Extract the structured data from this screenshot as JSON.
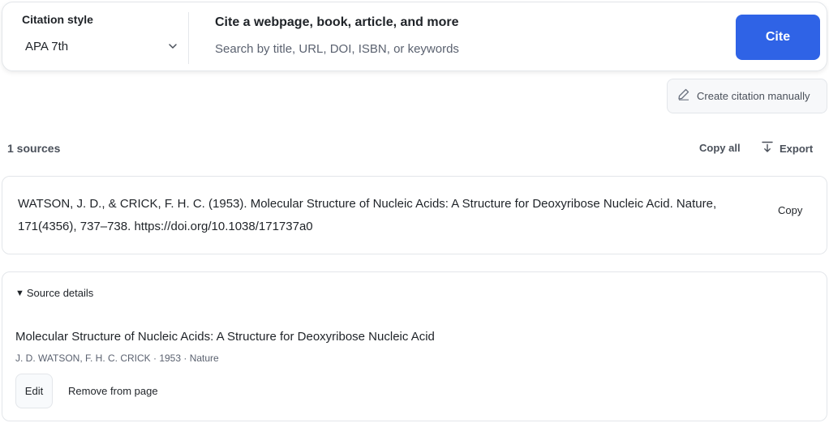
{
  "search": {
    "style_label": "Citation style",
    "style_value": "APA 7th",
    "title": "Cite a webpage, book, article, and more",
    "placeholder": "Search by title, URL, DOI, ISBN, or keywords",
    "cite_label": "Cite",
    "accent_color": "#2f63e6"
  },
  "manual": {
    "label": "Create citation manually"
  },
  "sources_bar": {
    "count": "1 sources",
    "copy_all": "Copy all",
    "export": "Export"
  },
  "citation": {
    "text": "WATSON, J. D., & CRICK, F. H. C. (1953). Molecular Structure of Nucleic Acids: A Structure for Deoxyribose Nucleic Acid. Nature, 171(4356), 737–738. https://doi.org/10.1038/171737a0",
    "copy_label": "Copy"
  },
  "details": {
    "toggle_label": "Source details",
    "title": "Molecular Structure of Nucleic Acids: A Structure for Deoxyribose Nucleic Acid",
    "meta": "J. D. WATSON, F. H. C. CRICK · 1953 · Nature",
    "edit_label": "Edit",
    "remove_label": "Remove from page"
  },
  "icons": {
    "chevron": "chevron-down-icon",
    "pencil": "pencil-icon",
    "export": "export-icon",
    "triangle": "triangle-down-icon"
  }
}
